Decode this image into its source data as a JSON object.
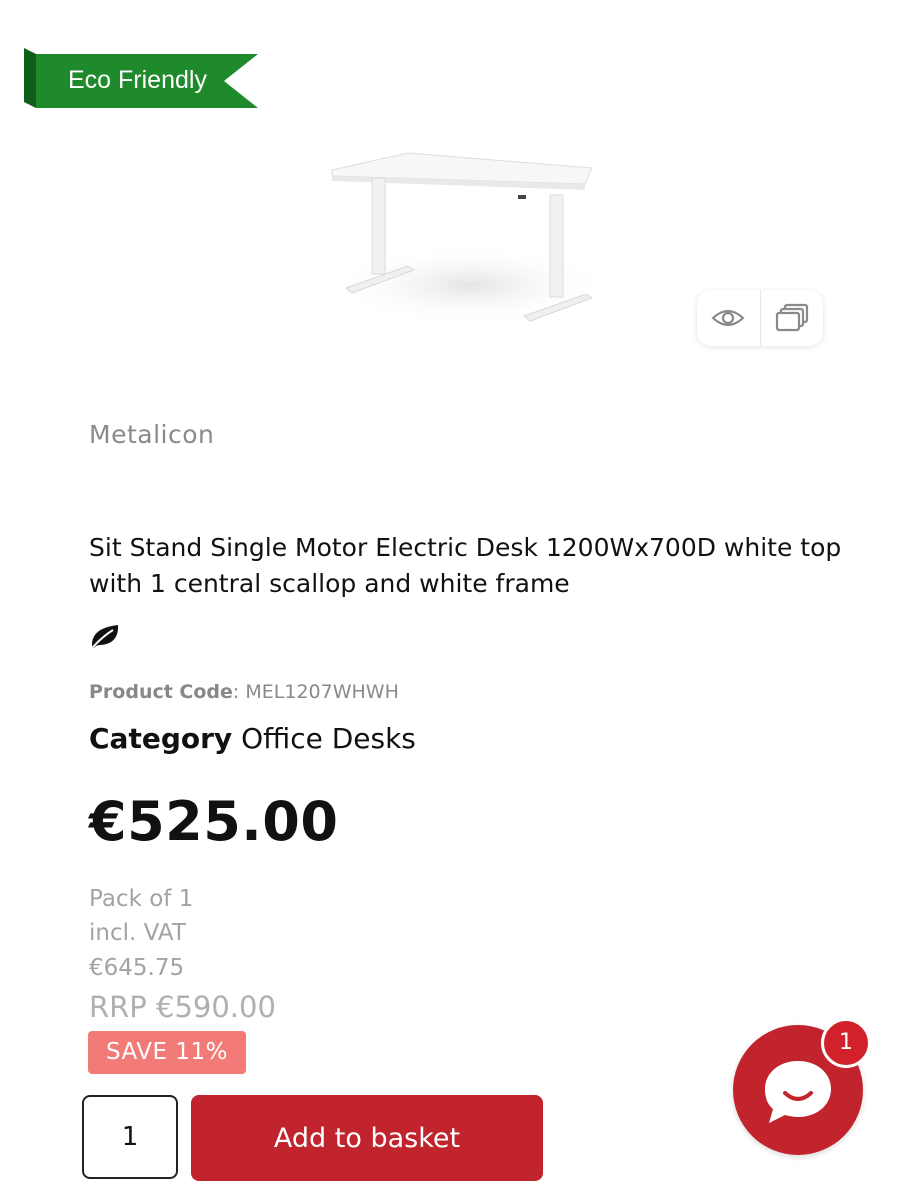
{
  "badge": {
    "label": "Eco Friendly",
    "color": "#1e8a2b"
  },
  "image_actions": {
    "quick_view_icon": "eye-icon",
    "compare_icon": "compare-icon"
  },
  "product": {
    "brand": "Metalicon",
    "title": "Sit Stand Single Motor Electric Desk 1200Wx700D white top with 1 central scallop and white frame",
    "eco_icon": "leaf-icon",
    "code_label": "Product Code",
    "code_value": "MEL1207WHWH",
    "category_label": "Category",
    "category_value": "Office Desks",
    "price": "€525.00",
    "pack": "Pack of 1",
    "vat_note": "incl. VAT",
    "price_incl_vat": "€645.75",
    "rrp": "RRP €590.00",
    "save": "SAVE 11%"
  },
  "cart": {
    "quantity": "1",
    "add_label": "Add to basket",
    "accent": "#c2242d"
  },
  "chat": {
    "icon": "chat-bubble-icon",
    "unread_count": "1"
  }
}
